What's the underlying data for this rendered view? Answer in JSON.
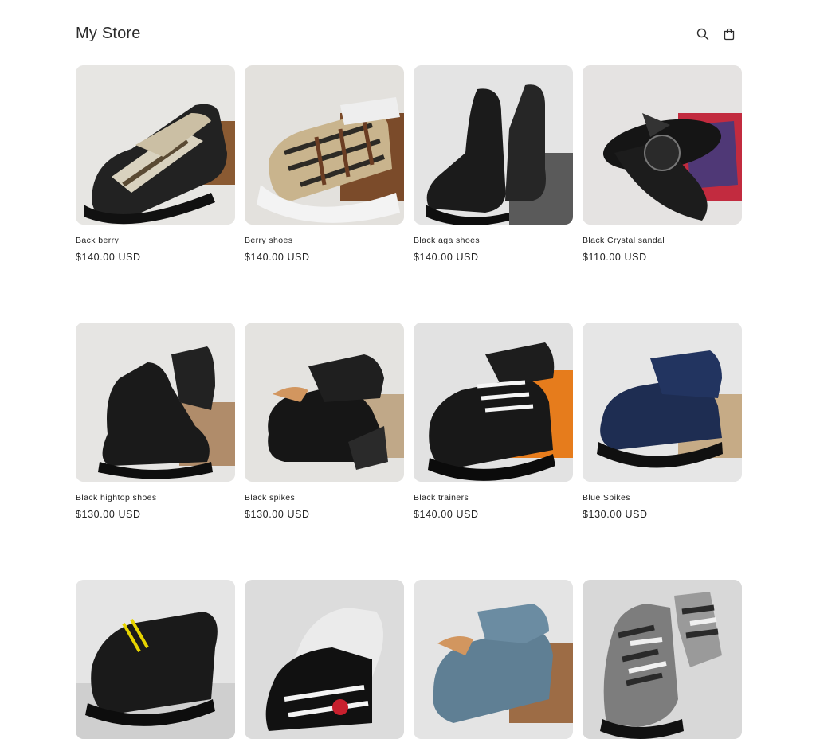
{
  "header": {
    "store_name": "My Store",
    "icons": [
      "search-icon",
      "cart-icon"
    ]
  },
  "products": [
    {
      "title": "Back berry",
      "price": "$140.00 USD",
      "image": "plaid-sneaker-black",
      "bg": "#e7e6e3"
    },
    {
      "title": "Berry shoes",
      "price": "$140.00 USD",
      "image": "plaid-sneaker-white-sole",
      "bg": "#e3e1dd"
    },
    {
      "title": "Black aga shoes",
      "price": "$140.00 USD",
      "image": "black-sock-sneaker",
      "bg": "#e4e4e4"
    },
    {
      "title": "Black Crystal sandal",
      "price": "$110.00 USD",
      "image": "black-thong-sandal",
      "bg": "#e5e3e2"
    },
    {
      "title": "Black hightop shoes",
      "price": "$130.00 USD",
      "image": "black-suede-hightop",
      "bg": "#e6e5e3"
    },
    {
      "title": "Black spikes",
      "price": "$130.00 USD",
      "image": "black-spike-sneaker",
      "bg": "#e4e3e0"
    },
    {
      "title": "Black trainers",
      "price": "$140.00 USD",
      "image": "black-trainer-orange-box",
      "bg": "#e2e2e2"
    },
    {
      "title": "Blue Spikes",
      "price": "$130.00 USD",
      "image": "navy-spike-sneaker",
      "bg": "#e6e6e6"
    },
    {
      "title": "",
      "price": "",
      "image": "black-crystal-sneaker",
      "bg": "#e5e5e5"
    },
    {
      "title": "",
      "price": "",
      "image": "graffiti-sneaker",
      "bg": "#e3e3e3"
    },
    {
      "title": "",
      "price": "",
      "image": "grey-suede-sneaker",
      "bg": "#e4e4e4"
    },
    {
      "title": "",
      "price": "",
      "image": "camo-hightop",
      "bg": "#e6e6e6"
    }
  ]
}
